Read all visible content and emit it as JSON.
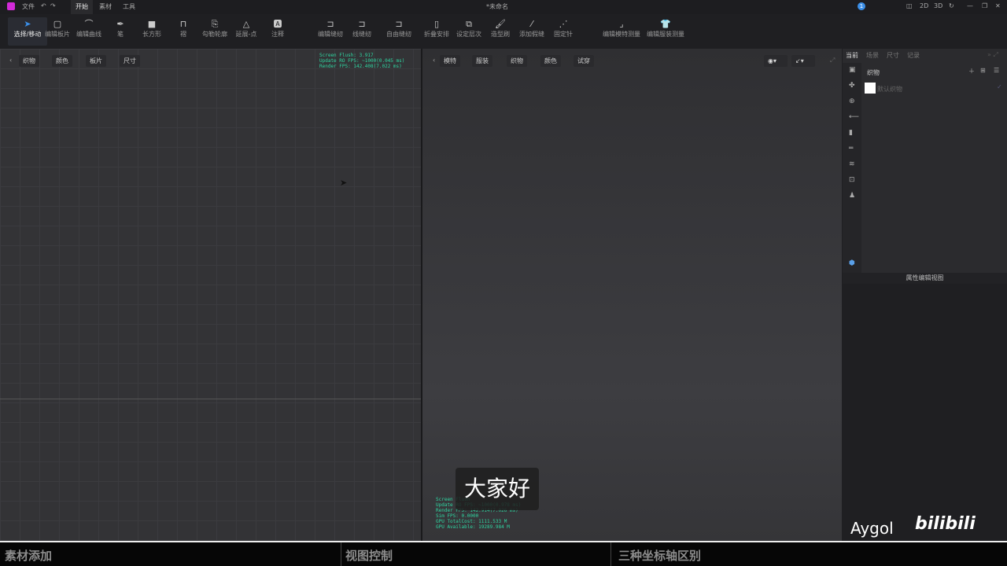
{
  "titlebar": {
    "menus": [
      "文件",
      "开始",
      "素材",
      "工具"
    ],
    "doc_title": "*未命名",
    "notif_count": "1",
    "view_buttons": [
      "2D",
      "3D"
    ]
  },
  "toolbar": {
    "tools": [
      "选择/移动",
      "编辑板片",
      "编辑曲线",
      "笔",
      "长方形",
      "褶",
      "勾勒轮廓",
      "延展-点",
      "注释",
      "编辑缝纫",
      "线缝纫",
      "自由缝纫",
      "折叠安排",
      "设定层次",
      "造型刷",
      "添加假缝",
      "固定针",
      "编辑模特测量",
      "编辑服装测量"
    ]
  },
  "left_view": {
    "chips": [
      "织物",
      "颜色",
      "板片",
      "尺寸"
    ],
    "fps": "Screen Flush: 3.917\nUpdate RO FPS: ~1000(0.045 ms)\nRender FPS: 142.408(7.022 ms)"
  },
  "right_view": {
    "chips": [
      "模特",
      "服装",
      "织物",
      "颜色",
      "试穿"
    ],
    "fps": "Screen Flush\nUpdate RO FPS: ~1000(0.978 ms)\nRender FPS: 142.914(7.026 ms)\nSim FPS: 0.0000\nGPU TotalCost: 1111.533 M\nGPU Available: 19289.984 M"
  },
  "panel": {
    "tabs": [
      "当前",
      "场景",
      "尺寸",
      "记录"
    ],
    "section": "织物",
    "item": "默认织物",
    "property_title": "属性编辑视图"
  },
  "subtitle": "大家好",
  "watermark": {
    "author": "Aygol",
    "logo": "bilibili"
  },
  "bottom_sections": [
    "素材添加",
    "视图控制",
    "三种坐标轴区别"
  ],
  "colors": {
    "accent": "#3b8fe8",
    "fps": "#2fd7a2"
  }
}
